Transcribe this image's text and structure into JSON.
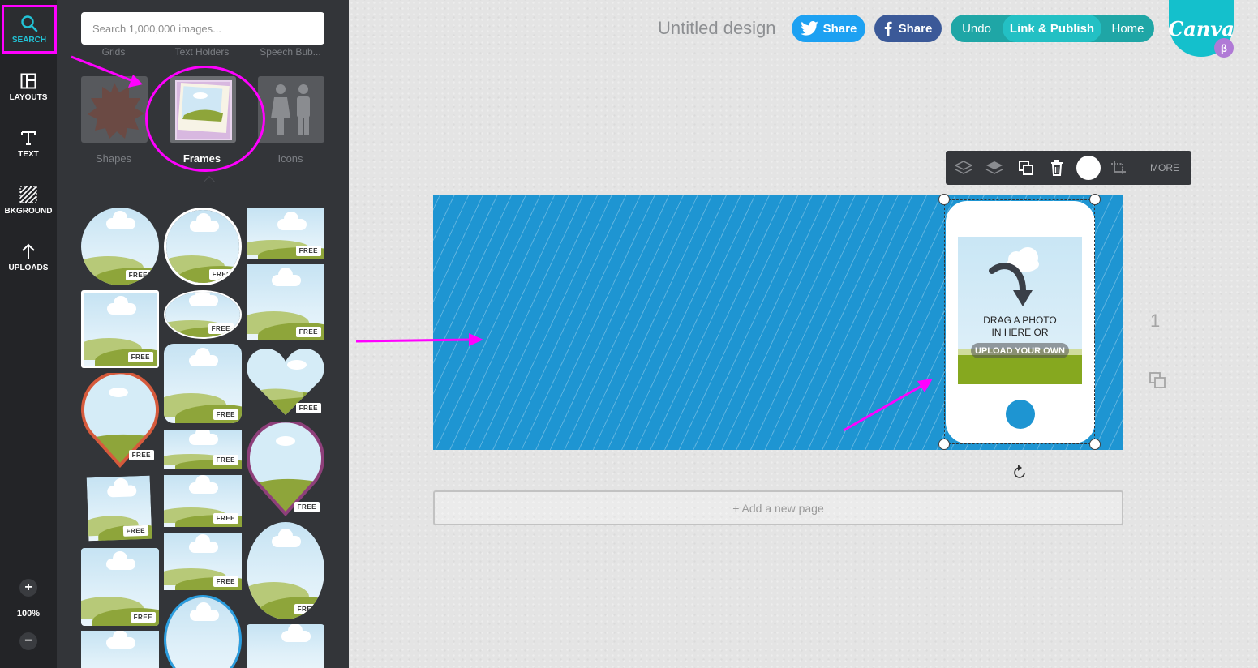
{
  "rail": {
    "items": [
      {
        "label": "SEARCH",
        "icon": "search-icon"
      },
      {
        "label": "LAYOUTS",
        "icon": "layouts-icon"
      },
      {
        "label": "TEXT",
        "icon": "text-icon"
      },
      {
        "label": "BKGROUND",
        "icon": "background-icon"
      },
      {
        "label": "UPLOADS",
        "icon": "upload-icon"
      }
    ],
    "zoom_plus": "+",
    "zoom_level": "100%",
    "zoom_minus": "−"
  },
  "panel": {
    "search_placeholder": "Search 1,000,000 images...",
    "top_categories": [
      "Grids",
      "Text Holders",
      "Speech Bub..."
    ],
    "categories": [
      {
        "label": "Shapes"
      },
      {
        "label": "Frames",
        "active": true
      },
      {
        "label": "Icons"
      }
    ],
    "free_label": "FREE"
  },
  "header": {
    "design_title": "Untitled design",
    "twitter_share": "Share",
    "facebook_share": "Share",
    "undo": "Undo",
    "link_publish": "Link & Publish",
    "home": "Home",
    "logo": "Canva",
    "beta": "β"
  },
  "toolbar": {
    "more": "MORE"
  },
  "canvas": {
    "drag_text_line1": "DRAG A PHOTO",
    "drag_text_line2": "IN HERE OR",
    "upload_own": "UPLOAD YOUR OWN",
    "add_page": "+ Add a new page",
    "page_number": "1"
  },
  "colors": {
    "accent": "#22c3d6",
    "canvas_blue": "#1e95d2",
    "annotation": "#ff00ff",
    "twitter": "#1da1f2",
    "facebook": "#3b5998"
  }
}
